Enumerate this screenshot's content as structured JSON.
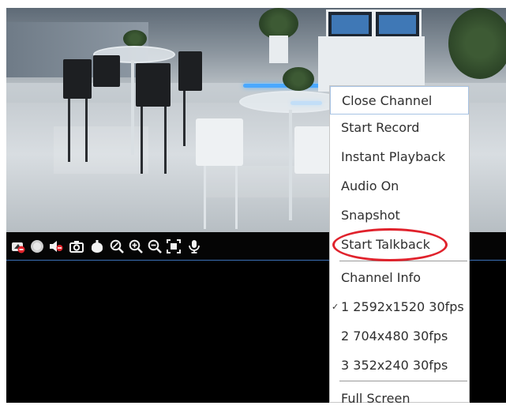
{
  "video": {
    "panel_name": "camera-view"
  },
  "toolbar": {
    "icons": [
      "hide-toolbar-icon",
      "record-icon",
      "audio-mute-icon",
      "snapshot-icon",
      "ptz-icon",
      "digital-zoom-icon",
      "zoom-in-icon",
      "zoom-out-icon",
      "full-frame-icon",
      "talkback-microphone-icon"
    ],
    "record_color": "#cfcfcf",
    "mute_color": "#e2252d"
  },
  "context_menu": {
    "items": [
      {
        "label": "Close Channel"
      },
      {
        "label": "Start Record"
      },
      {
        "label": "Instant Playback"
      },
      {
        "label": "Audio On"
      },
      {
        "label": "Snapshot"
      },
      {
        "label": "Start Talkback"
      },
      {
        "label": "Channel Info"
      },
      {
        "label": "1 2592x1520 30fps",
        "checked": true,
        "check_glyph": "✓"
      },
      {
        "label": "2 704x480 30fps"
      },
      {
        "label": "3 352x240 30fps"
      },
      {
        "label": "Full Screen"
      }
    ],
    "highlighted_item": "Start Talkback",
    "highlight_color": "#e0222c"
  }
}
